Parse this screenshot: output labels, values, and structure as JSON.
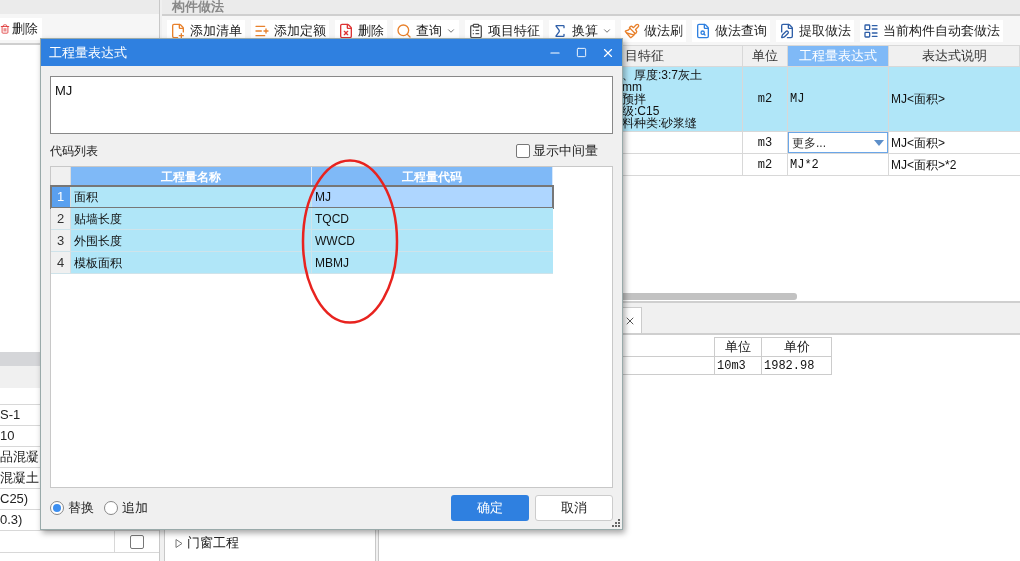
{
  "left_panel": {
    "toolbar": [
      {
        "label": "删除"
      }
    ],
    "rows": [
      "S-1",
      "10",
      "品混凝",
      "混凝土",
      "C25)",
      "0.3)"
    ],
    "checkbox": {
      "checked": false
    }
  },
  "method_panel": {
    "title": "构件做法",
    "toolbar": [
      {
        "label": "添加清单",
        "kind": "button"
      },
      {
        "label": "添加定额",
        "kind": "button"
      },
      {
        "label": "删除",
        "kind": "button"
      },
      {
        "label": "查询",
        "kind": "dropdown"
      },
      {
        "label": "项目特征",
        "kind": "button"
      },
      {
        "label": "换算",
        "kind": "dropdown"
      },
      {
        "label": "做法刷",
        "kind": "button"
      },
      {
        "label": "做法查询",
        "kind": "button"
      },
      {
        "label": "提取做法",
        "kind": "button"
      },
      {
        "label": "当前构件自动套做法",
        "kind": "button"
      }
    ],
    "table": {
      "columns": [
        {
          "label": "目特征",
          "selected": false
        },
        {
          "label": "单位",
          "selected": false
        },
        {
          "label": "工程量表达式",
          "selected": true
        },
        {
          "label": "表达式说明",
          "selected": false
        }
      ],
      "rows": [
        {
          "selected": true,
          "features": [
            "、厚度:3:7灰土",
            "mm",
            "预拌",
            "级:C15",
            "料种类:砂浆缝"
          ],
          "unit": "m2",
          "expression": {
            "kind": "text",
            "value": "MJ"
          },
          "explanation": "MJ<面积>"
        },
        {
          "selected": false,
          "unit": "m3",
          "expression": {
            "kind": "dropdown",
            "value": "更多..."
          },
          "explanation": "MJ<面积>"
        },
        {
          "selected": false,
          "unit": "m2",
          "expression": {
            "kind": "text",
            "value": "MJ*2"
          },
          "explanation": "MJ<面积>*2"
        }
      ]
    }
  },
  "tree": {
    "items": [
      {
        "label": "门窗工程",
        "expanded": false
      }
    ]
  },
  "detail": {
    "table": {
      "columns": [
        "单位",
        "单价"
      ],
      "rows": [
        [
          "10m3",
          "1982.98"
        ]
      ]
    }
  },
  "dialog": {
    "title": "工程量表达式",
    "expression": "MJ",
    "list_label": "代码列表",
    "show_intermediate": {
      "label": "显示中间量",
      "checked": false
    },
    "grid": {
      "columns": [
        "工程量名称",
        "工程量代码"
      ],
      "rows": [
        {
          "index": "1",
          "name": "面积",
          "code": "MJ",
          "selected": true
        },
        {
          "index": "2",
          "name": "贴墙长度",
          "code": "TQCD",
          "selected": false
        },
        {
          "index": "3",
          "name": "外围长度",
          "code": "WWCD",
          "selected": false
        },
        {
          "index": "4",
          "name": "模板面积",
          "code": "MBMJ",
          "selected": false
        }
      ]
    },
    "modes": [
      {
        "label": "替换",
        "selected": true
      },
      {
        "label": "追加",
        "selected": false
      }
    ],
    "buttons": [
      {
        "label": "确定",
        "kind": "primary"
      },
      {
        "label": "取消",
        "kind": "secondary"
      }
    ]
  },
  "annotation": {
    "kind": "ellipse"
  }
}
